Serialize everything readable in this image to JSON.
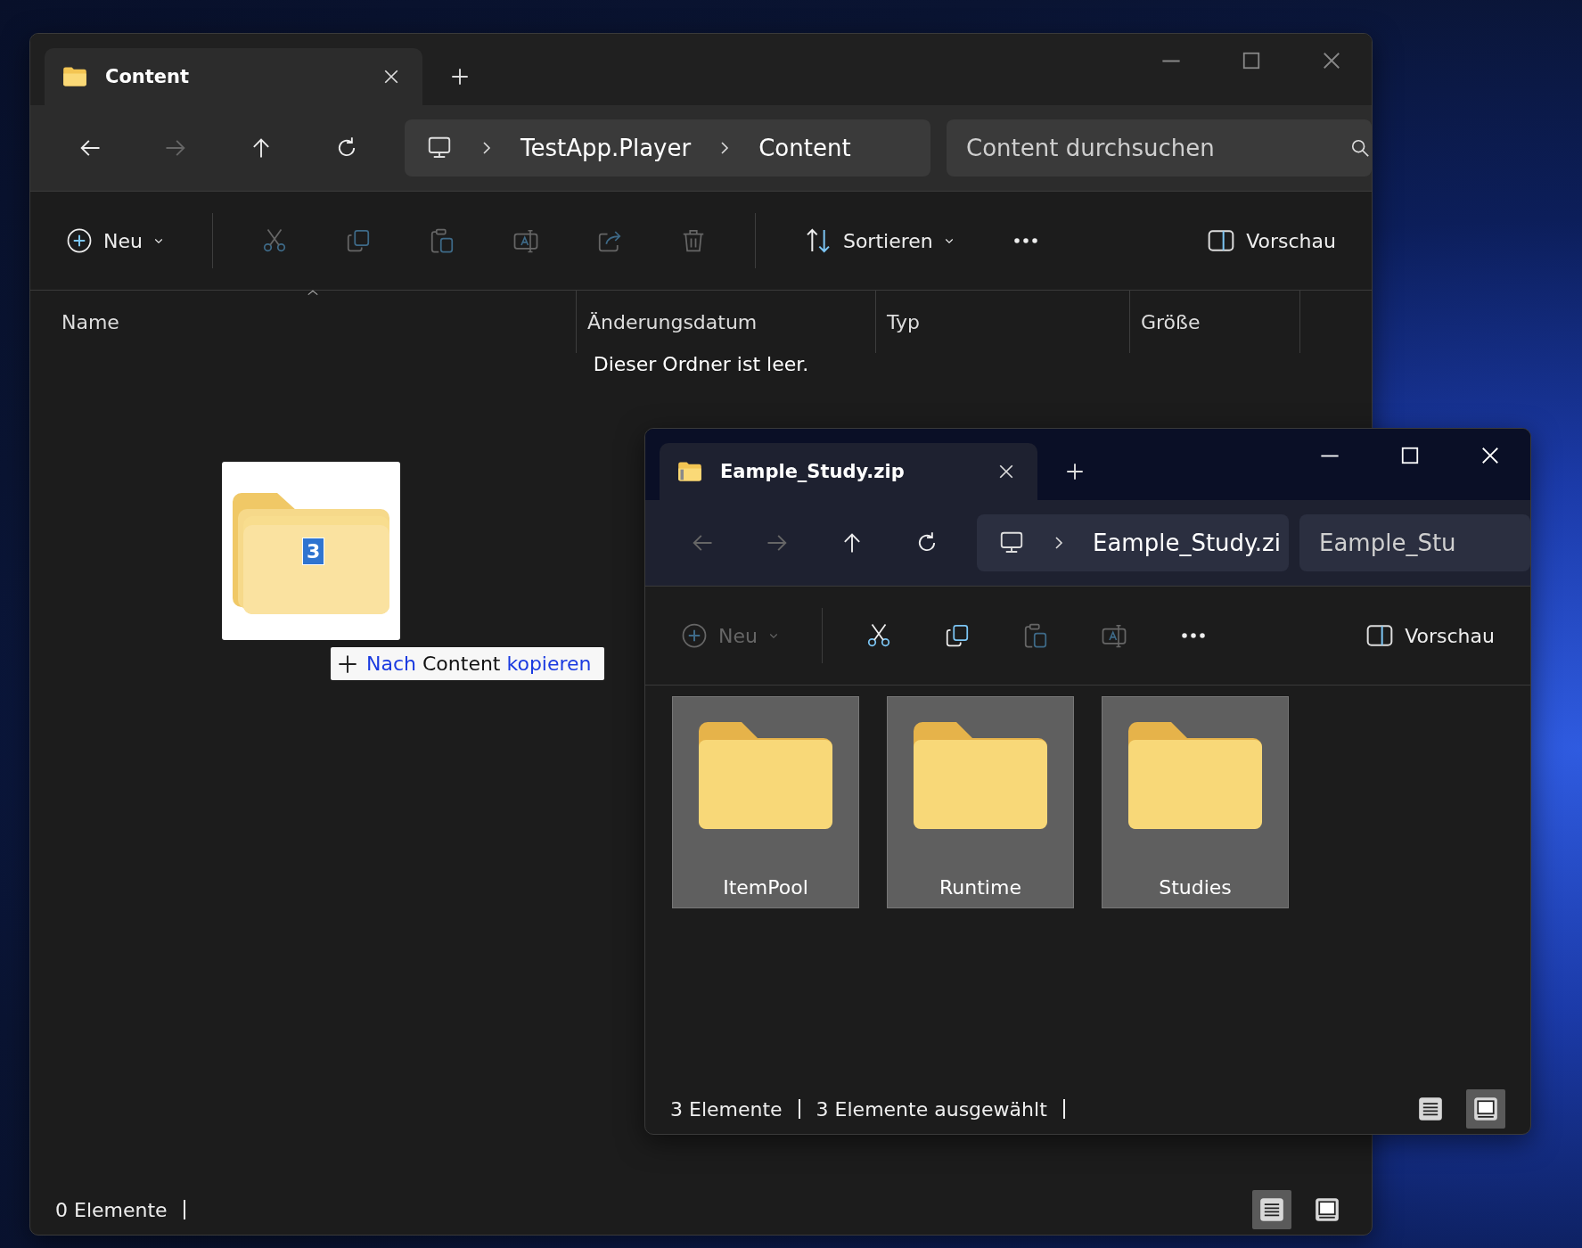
{
  "windows": [
    {
      "kind": "folder",
      "active": false,
      "tab": {
        "title": "Content"
      },
      "nav": {
        "back_disabled": false,
        "forward_disabled": true
      },
      "breadcrumbs": [
        "TestApp.Player",
        "Content"
      ],
      "search": {
        "placeholder": "Content durchsuchen"
      },
      "toolbar": [
        {
          "kind": "new",
          "label": "Neu",
          "disabled": false
        },
        {
          "kind": "cut",
          "disabled": true
        },
        {
          "kind": "copy",
          "disabled": true
        },
        {
          "kind": "paste",
          "disabled": true
        },
        {
          "kind": "rename",
          "disabled": true
        },
        {
          "kind": "share",
          "disabled": true
        },
        {
          "kind": "delete",
          "disabled": true
        },
        {
          "kind": "sort",
          "label": "Sortieren",
          "disabled": false
        },
        {
          "kind": "more",
          "disabled": false
        }
      ],
      "preview": "Vorschau",
      "columns": [
        "Name",
        "Änderungsdatum",
        "Typ",
        "Größe"
      ],
      "empty_message": "Dieser Ordner ist leer.",
      "status": [
        "0 Elemente"
      ],
      "views": [
        {
          "kind": "details",
          "selected": true
        },
        {
          "kind": "tiles",
          "selected": false
        }
      ]
    },
    {
      "kind": "zip",
      "active": true,
      "tab": {
        "title": "Eample_Study.zip"
      },
      "nav": {
        "back_disabled": true,
        "forward_disabled": true
      },
      "breadcrumbs": [
        "Eample_Study.zi"
      ],
      "search": {
        "placeholder": "Eample_Stu"
      },
      "toolbar": [
        {
          "kind": "new",
          "label": "Neu",
          "disabled": true
        },
        {
          "kind": "cut",
          "disabled": false
        },
        {
          "kind": "copy",
          "disabled": false
        },
        {
          "kind": "paste",
          "disabled": true
        },
        {
          "kind": "rename",
          "disabled": true
        },
        {
          "kind": "more",
          "disabled": false
        }
      ],
      "preview": "Vorschau",
      "items": [
        {
          "name": "ItemPool",
          "selected": true
        },
        {
          "name": "Runtime",
          "selected": true
        },
        {
          "name": "Studies",
          "selected": true
        }
      ],
      "status": [
        "3 Elemente",
        "3 Elemente ausgewählt"
      ],
      "views": [
        {
          "kind": "details",
          "selected": false
        },
        {
          "kind": "tiles",
          "selected": true
        }
      ]
    }
  ],
  "drag": {
    "count": "3",
    "tooltip": [
      {
        "text": "Nach",
        "kind": "action"
      },
      {
        "text": "Content",
        "kind": "target"
      },
      {
        "text": "kopieren",
        "kind": "action"
      }
    ]
  }
}
